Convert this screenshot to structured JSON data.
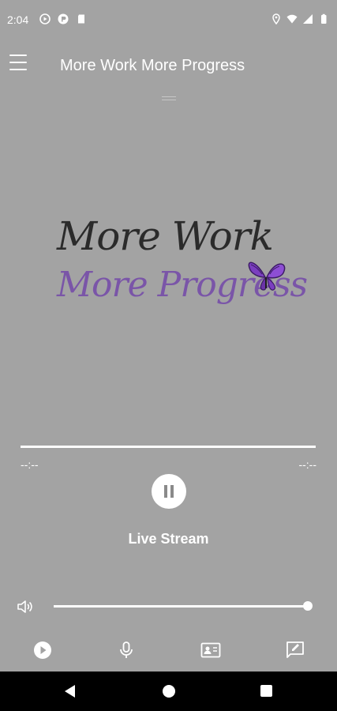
{
  "status_bar": {
    "time": "2:04",
    "left_icons": [
      "play-circle-icon",
      "news-icon",
      "sd-card-icon"
    ],
    "right_icons": [
      "location-icon",
      "wifi-icon",
      "cell-signal-icon",
      "battery-icon"
    ]
  },
  "app_bar": {
    "title": "More Work More Progress",
    "menu_icon": "hamburger-menu-icon"
  },
  "logo": {
    "line1": "More Work",
    "line2": "More Progress",
    "colors": {
      "line1": "#2b2b2b",
      "line2": "#7a55a8",
      "butterfly": "#7b3fc0"
    }
  },
  "player": {
    "elapsed": "--:--",
    "duration": "--:--",
    "progress": 1.0,
    "state_icon": "pause-icon",
    "stream_label": "Live Stream"
  },
  "volume": {
    "icon": "volume-icon",
    "level": 0.99
  },
  "bottom_nav": [
    {
      "icon": "play-icon"
    },
    {
      "icon": "microphone-icon"
    },
    {
      "icon": "contact-card-icon"
    },
    {
      "icon": "feedback-icon"
    }
  ],
  "colors": {
    "background": "#a3a3a3",
    "foreground": "#ffffff",
    "system_nav": "#000000"
  }
}
